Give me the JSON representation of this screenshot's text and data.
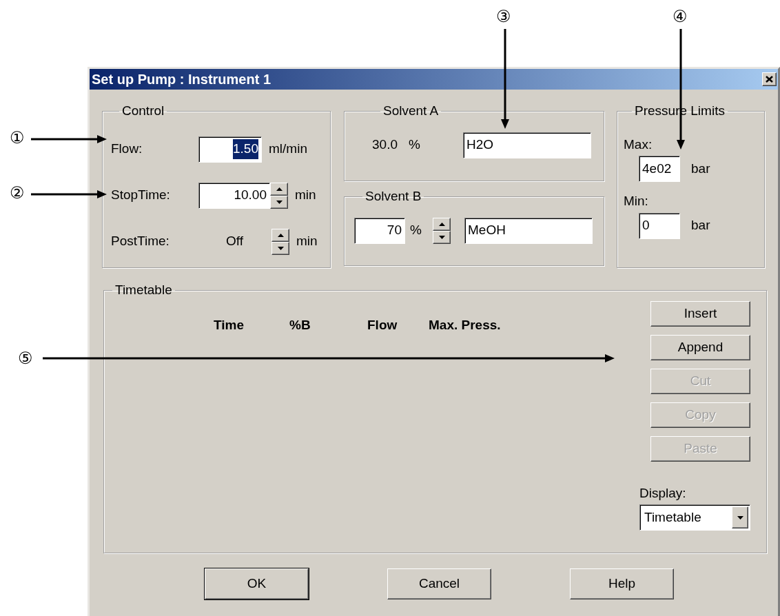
{
  "window": {
    "title": "Set up Pump : Instrument 1"
  },
  "control": {
    "title": "Control",
    "rows": [
      {
        "label": "Flow:",
        "kind": "field",
        "value": "1.50",
        "highlighted": true,
        "unit": "ml/min"
      },
      {
        "label": "StopTime:",
        "kind": "spinfield",
        "value": "10.00",
        "highlighted": false,
        "unit": "min"
      },
      {
        "label": "PostTime:",
        "kind": "spintext",
        "value": "Off",
        "highlighted": false,
        "unit": "min"
      }
    ]
  },
  "solvent_a": {
    "title": "Solvent A",
    "percent": "30.0",
    "percent_unit": "%",
    "name": "H2O"
  },
  "solvent_b": {
    "title": "Solvent B",
    "percent": "70",
    "percent_unit": "%",
    "name": "MeOH"
  },
  "pressure": {
    "title": "Pressure Limits",
    "limits": [
      {
        "label": "Max:",
        "value": "4e02",
        "unit": "bar"
      },
      {
        "label": "Min:",
        "value": "0",
        "unit": "bar"
      }
    ]
  },
  "timetable": {
    "title": "Timetable",
    "columns": [
      "Time",
      "%B",
      "Flow",
      "Max. Press."
    ],
    "buttons": [
      {
        "label": "Insert",
        "disabled": false
      },
      {
        "label": "Append",
        "disabled": false
      },
      {
        "label": "Cut",
        "disabled": true
      },
      {
        "label": "Copy",
        "disabled": true
      },
      {
        "label": "Paste",
        "disabled": true
      }
    ],
    "display": {
      "label": "Display:",
      "value": "Timetable"
    }
  },
  "buttons": [
    {
      "label": "OK",
      "default": true
    },
    {
      "label": "Cancel",
      "default": false
    },
    {
      "label": "Help",
      "default": false
    }
  ],
  "callouts": [
    {
      "label": "①"
    },
    {
      "label": "②"
    },
    {
      "label": "③"
    },
    {
      "label": "④"
    },
    {
      "label": "⑤"
    }
  ]
}
